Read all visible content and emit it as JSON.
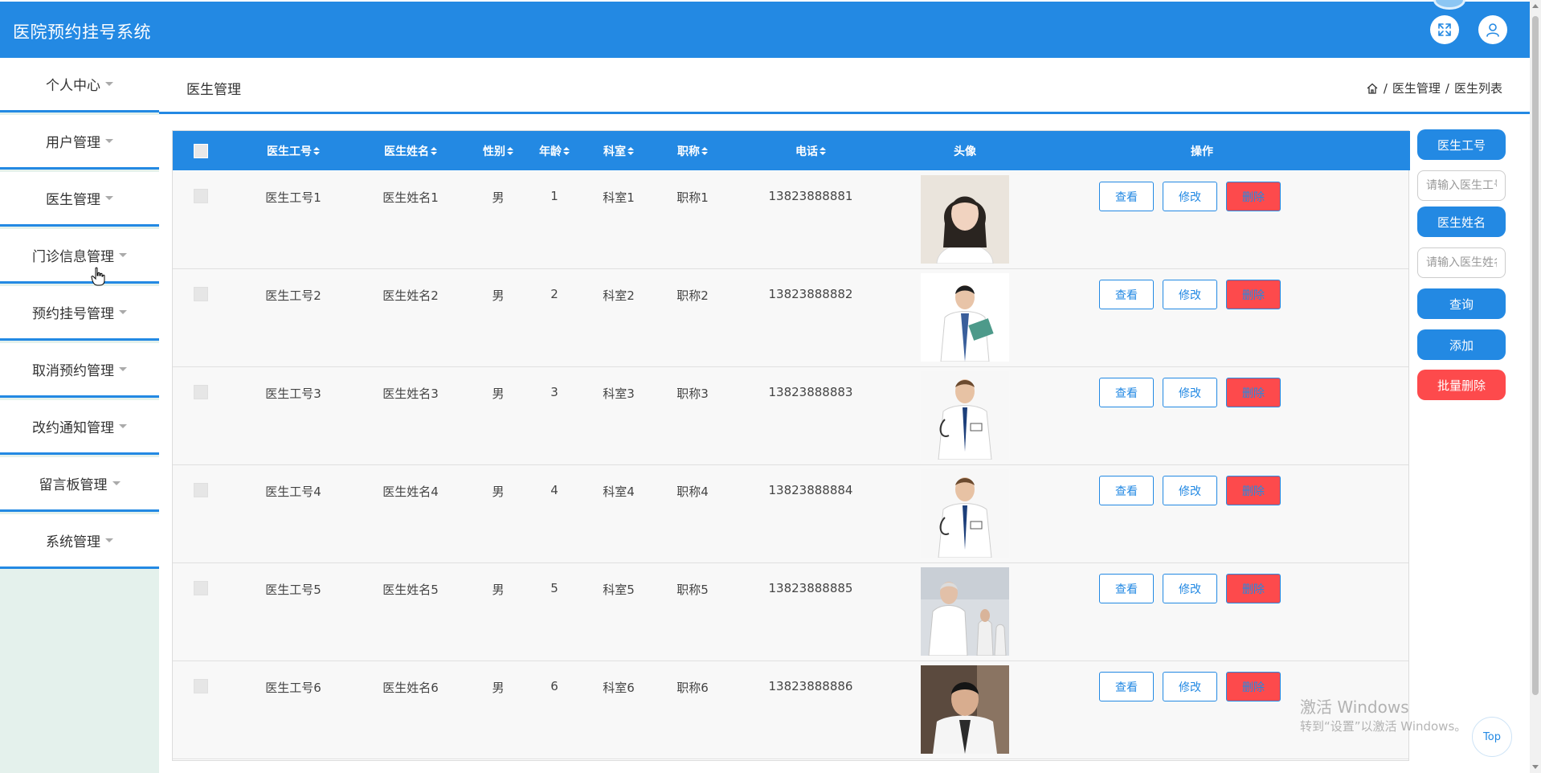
{
  "app": {
    "title": "医院预约挂号系统"
  },
  "header_icons": [
    "fullscreen-icon",
    "user-icon"
  ],
  "sidebar": {
    "items": [
      {
        "label": "个人中心"
      },
      {
        "label": "用户管理"
      },
      {
        "label": "医生管理"
      },
      {
        "label": "门诊信息管理"
      },
      {
        "label": "预约挂号管理"
      },
      {
        "label": "取消预约管理"
      },
      {
        "label": "改约通知管理"
      },
      {
        "label": "留言板管理"
      },
      {
        "label": "系统管理"
      }
    ]
  },
  "page": {
    "title": "医生管理",
    "breadcrumb": {
      "separator": "/",
      "items": [
        "医生管理",
        "医生列表"
      ]
    }
  },
  "table": {
    "columns": [
      "医生工号",
      "医生姓名",
      "性别",
      "年龄",
      "科室",
      "职称",
      "电话",
      "头像",
      "操作"
    ],
    "action_labels": {
      "view": "查看",
      "edit": "修改",
      "delete": "删除"
    },
    "rows": [
      {
        "id": "医生工号1",
        "name": "医生姓名1",
        "gender": "男",
        "age": "1",
        "dept": "科室1",
        "title": "职称1",
        "phone": "13823888881"
      },
      {
        "id": "医生工号2",
        "name": "医生姓名2",
        "gender": "男",
        "age": "2",
        "dept": "科室2",
        "title": "职称2",
        "phone": "13823888882"
      },
      {
        "id": "医生工号3",
        "name": "医生姓名3",
        "gender": "男",
        "age": "3",
        "dept": "科室3",
        "title": "职称3",
        "phone": "13823888883"
      },
      {
        "id": "医生工号4",
        "name": "医生姓名4",
        "gender": "男",
        "age": "4",
        "dept": "科室4",
        "title": "职称4",
        "phone": "13823888884"
      },
      {
        "id": "医生工号5",
        "name": "医生姓名5",
        "gender": "男",
        "age": "5",
        "dept": "科室5",
        "title": "职称5",
        "phone": "13823888885"
      },
      {
        "id": "医生工号6",
        "name": "医生姓名6",
        "gender": "男",
        "age": "6",
        "dept": "科室6",
        "title": "职称6",
        "phone": "13823888886"
      }
    ]
  },
  "search_panel": {
    "field1_label": "医生工号",
    "field1_placeholder": "请输入医生工号",
    "field2_label": "医生姓名",
    "field2_placeholder": "请输入医生姓名",
    "query_label": "查询",
    "add_label": "添加",
    "batch_delete_label": "批量删除"
  },
  "watermark": {
    "line1": "激活 Windows",
    "line2": "转到“设置”以激活 Windows。"
  },
  "top_button": {
    "label": "Top"
  },
  "colors": {
    "primary": "#2389e3",
    "danger": "#fd4a4c",
    "sidebar_bg": "#e4f1ec"
  }
}
